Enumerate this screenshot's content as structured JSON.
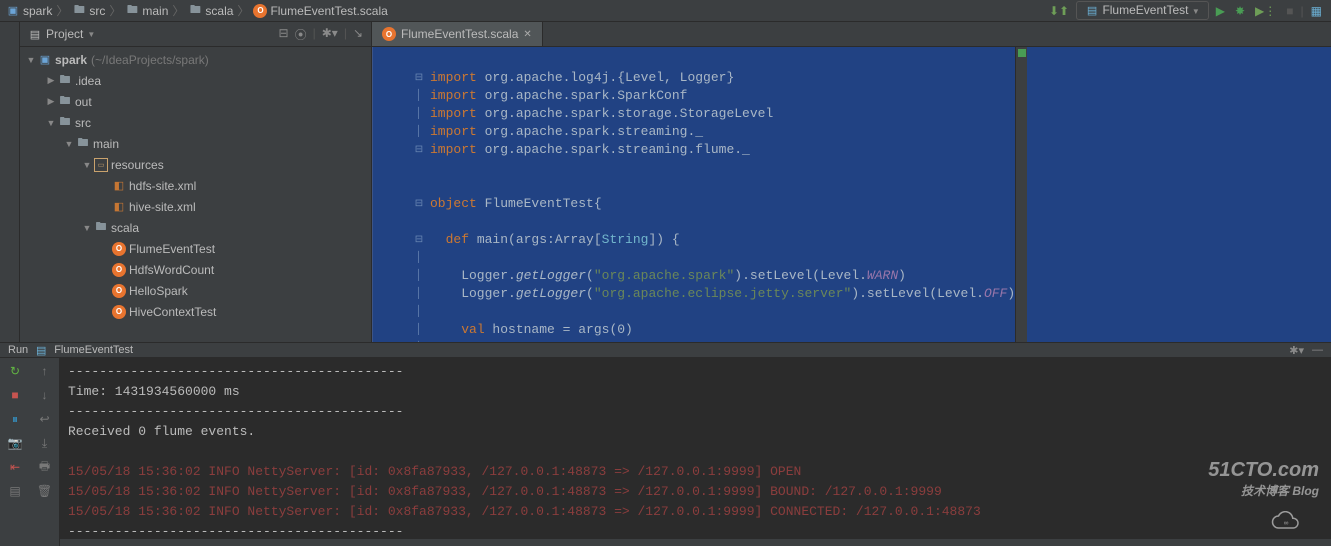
{
  "breadcrumb": {
    "items": [
      {
        "icon": "module",
        "label": "spark"
      },
      {
        "icon": "folder",
        "label": "src"
      },
      {
        "icon": "folder",
        "label": "main"
      },
      {
        "icon": "folder",
        "label": "scala"
      },
      {
        "icon": "scala",
        "label": "FlumeEventTest.scala"
      }
    ],
    "run_config": "FlumeEventTest"
  },
  "project_panel": {
    "title": "Project",
    "root": {
      "label": "spark",
      "hint": "(~/IdeaProjects/spark)"
    },
    "tree": [
      {
        "depth": 1,
        "arrow": "closed",
        "icon": "folder",
        "label": ".idea"
      },
      {
        "depth": 1,
        "arrow": "closed",
        "icon": "folder",
        "label": "out"
      },
      {
        "depth": 1,
        "arrow": "open",
        "icon": "folder",
        "label": "src"
      },
      {
        "depth": 2,
        "arrow": "open",
        "icon": "folder",
        "label": "main"
      },
      {
        "depth": 3,
        "arrow": "open",
        "icon": "resources",
        "label": "resources"
      },
      {
        "depth": 4,
        "arrow": "none",
        "icon": "xml",
        "label": "hdfs-site.xml"
      },
      {
        "depth": 4,
        "arrow": "none",
        "icon": "xml",
        "label": "hive-site.xml"
      },
      {
        "depth": 3,
        "arrow": "open",
        "icon": "folder",
        "label": "scala"
      },
      {
        "depth": 4,
        "arrow": "none",
        "icon": "class",
        "label": "FlumeEventTest"
      },
      {
        "depth": 4,
        "arrow": "none",
        "icon": "class",
        "label": "HdfsWordCount"
      },
      {
        "depth": 4,
        "arrow": "none",
        "icon": "class",
        "label": "HelloSpark"
      },
      {
        "depth": 4,
        "arrow": "none",
        "icon": "class",
        "label": "HiveContextTest"
      }
    ]
  },
  "editor": {
    "tab_label": "FlumeEventTest.scala",
    "code_lines": [
      "",
      "import org.apache.log4j.{Level, Logger}",
      "import org.apache.spark.SparkConf",
      "import org.apache.spark.storage.StorageLevel",
      "import org.apache.spark.streaming._",
      "import org.apache.spark.streaming.flume._",
      "",
      "",
      "object FlumeEventTest{",
      "",
      "  def main(args:Array[String]) {",
      "",
      "    Logger.getLogger(\"org.apache.spark\").setLevel(Level.WARN)",
      "    Logger.getLogger(\"org.apache.eclipse.jetty.server\").setLevel(Level.OFF)",
      "",
      "    val hostname = args(0)"
    ]
  },
  "run": {
    "header": "Run",
    "config": "FlumeEventTest",
    "console_lines": [
      {
        "cls": "dash",
        "text": "-------------------------------------------"
      },
      {
        "cls": "",
        "text": "Time: 1431934560000 ms"
      },
      {
        "cls": "dash",
        "text": "-------------------------------------------"
      },
      {
        "cls": "",
        "text": "Received 0 flume events."
      },
      {
        "cls": "",
        "text": ""
      },
      {
        "cls": "log-red",
        "text": "15/05/18 15:36:02 INFO NettyServer: [id: 0x8fa87933, /127.0.0.1:48873 => /127.0.0.1:9999] OPEN"
      },
      {
        "cls": "log-red",
        "text": "15/05/18 15:36:02 INFO NettyServer: [id: 0x8fa87933, /127.0.0.1:48873 => /127.0.0.1:9999] BOUND: /127.0.0.1:9999"
      },
      {
        "cls": "log-red",
        "text": "15/05/18 15:36:02 INFO NettyServer: [id: 0x8fa87933, /127.0.0.1:48873 => /127.0.0.1:9999] CONNECTED: /127.0.0.1:48873"
      },
      {
        "cls": "dash",
        "text": "-------------------------------------------"
      }
    ]
  },
  "watermark": {
    "big": "51CTO.com",
    "small": "技术博客 Blog"
  }
}
